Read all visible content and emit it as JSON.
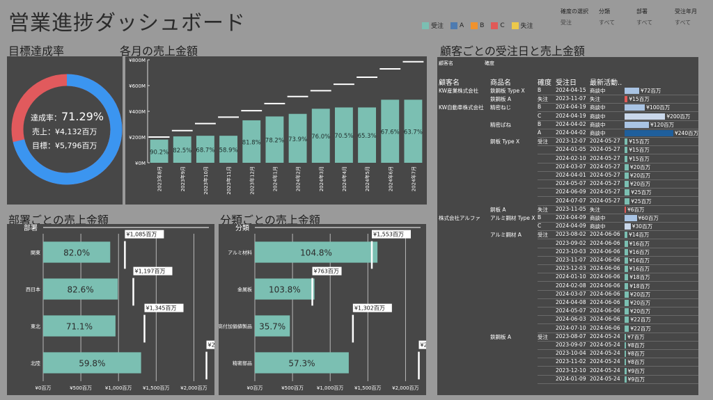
{
  "title": "営業進捗ダッシュボード",
  "legend": [
    {
      "label": "受注",
      "color": "#7bbfb2"
    },
    {
      "label": "A",
      "color": "#4e7bb0"
    },
    {
      "label": "B",
      "color": "#f0922e"
    },
    {
      "label": "C",
      "color": "#e15a57"
    },
    {
      "label": "失注",
      "color": "#ecc94b"
    }
  ],
  "filters": [
    {
      "label": "確度の選択",
      "value": "受注"
    },
    {
      "label": "分類",
      "value": "すべて"
    },
    {
      "label": "部署",
      "value": "すべて"
    },
    {
      "label": "受注年月",
      "value": "すべて"
    }
  ],
  "sections": {
    "goal": "目標達成率",
    "monthly": "各月の売上金額",
    "dept": "部署ごとの売上金額",
    "category": "分類ごとの売上金額",
    "customer": "顧客ごとの受注日と売上金額"
  },
  "goal": {
    "rate_label": "達成率：",
    "rate_value": "71.29%",
    "rate": 0.7129,
    "sales_label": "売上：",
    "sales_value": "¥4,132百万",
    "target_label": "目標：",
    "target_value": "¥5,796百万",
    "achieved_color": "#3b95f0",
    "remaining_color": "#e15a5d"
  },
  "chart_data": [
    {
      "type": "bar",
      "title": "各月の売上金額",
      "categories": [
        "2023年8月",
        "2023年9月",
        "2023年10月",
        "2023年11月",
        "2023年12月",
        "2024年1月",
        "2024年2月",
        "2024年3月",
        "2024年4月",
        "2024年5月",
        "2024年6月",
        "2024年7月"
      ],
      "values": [
        180,
        205,
        210,
        210,
        330,
        360,
        380,
        420,
        430,
        430,
        490,
        490
      ],
      "targets": [
        200,
        250,
        305,
        355,
        405,
        460,
        515,
        560,
        610,
        665,
        730,
        785
      ],
      "bar_labels": [
        "90.2%",
        "82.5%",
        "68.7%",
        "58.9%",
        "81.8%",
        "78.2%",
        "73.9%",
        "76.0%",
        "70.5%",
        "65.3%",
        "67.6%",
        "63.7%"
      ],
      "yticks": [
        "¥0M",
        "¥200M",
        "¥400M",
        "¥600M",
        "¥800M"
      ],
      "ylim": [
        0,
        800
      ],
      "color": "#7bbfb2"
    },
    {
      "type": "bar",
      "title": "部署ごとの売上金額",
      "axis_header": "部署",
      "categories": [
        "関東",
        "西日本",
        "東北",
        "北陸"
      ],
      "values": [
        890,
        990,
        960,
        1300
      ],
      "targets": [
        1085,
        1197,
        1345,
        2168
      ],
      "bar_labels": [
        "82.0%",
        "82.6%",
        "71.1%",
        "59.8%"
      ],
      "target_labels": [
        "¥1,085百万",
        "¥1,197百万",
        "¥1,345百万",
        "¥2,168百万"
      ],
      "xticks": [
        "¥0百万",
        "¥500百万",
        "¥1,000百万",
        "¥1,500百万",
        "¥2,000百万"
      ],
      "xlim": [
        0,
        2200
      ],
      "color": "#7bbfb2"
    },
    {
      "type": "bar",
      "title": "分類ごとの売上金額",
      "axis_header": "分類",
      "categories": [
        "アルミ材料",
        "金属板",
        "高付加価値製品",
        "精密部品"
      ],
      "values": [
        1628,
        792,
        465,
        1247
      ],
      "targets": [
        1553,
        763,
        1302,
        2177
      ],
      "bar_labels": [
        "104.8%",
        "103.8%",
        "35.7%",
        "57.3%"
      ],
      "target_labels": [
        "¥1,553百万",
        "¥763百万",
        "¥1,302百万",
        "¥2,177百万"
      ],
      "xticks": [
        "¥0百万",
        "¥500百万",
        "¥1,000百万",
        "¥1,500百万",
        "¥2,000百万"
      ],
      "xlim": [
        0,
        2200
      ],
      "color": "#7bbfb2"
    }
  ],
  "customer_table": {
    "filter_labels": [
      "顧客名",
      "確度"
    ],
    "columns": [
      "顧客名",
      "商品名",
      "確度",
      "受注日",
      "最新活動.."
    ],
    "bar_scale_max": 240,
    "rows": [
      {
        "customer": "KW産業株式会社",
        "product": "鉄鋼板 Type X",
        "grade": "B",
        "date": "2024-04-15",
        "activity": "商談中",
        "amount": 72,
        "label": "¥72百万",
        "color": "#a9c4e4"
      },
      {
        "customer": "",
        "product": "鉄鋼板 A",
        "grade": "失注",
        "date": "2023-11-07",
        "activity": "失注",
        "amount": 15,
        "label": "¥15百万",
        "color": "#e15a57"
      },
      {
        "customer": "KW自動車株式会社",
        "product": "精密ねじ",
        "grade": "B",
        "date": "2024-04-19",
        "activity": "商談中",
        "amount": 100,
        "label": "¥100百万",
        "color": "#a9c4e4"
      },
      {
        "customer": "",
        "product": "",
        "grade": "C",
        "date": "2024-04-19",
        "activity": "商談中",
        "amount": 200,
        "label": "¥200百万",
        "color": "#c9d7ea"
      },
      {
        "customer": "",
        "product": "精密ばね",
        "grade": "B",
        "date": "2024-04-02",
        "activity": "商談中",
        "amount": 120,
        "label": "¥120百万",
        "color": "#a9c4e4"
      },
      {
        "customer": "",
        "product": "",
        "grade": "A",
        "date": "2024-04-02",
        "activity": "商談中",
        "amount": 240,
        "label": "¥240百万",
        "color": "#1f5f9c"
      },
      {
        "customer": "",
        "product": "銅板 Type X",
        "grade": "受注",
        "date": "2023-12-07",
        "activity": "2024-05-27",
        "amount": 15,
        "label": "¥15百万",
        "color": "#7bbfb2"
      },
      {
        "customer": "",
        "product": "",
        "grade": "",
        "date": "2024-01-05",
        "activity": "2024-05-27",
        "amount": 15,
        "label": "¥15百万",
        "color": "#7bbfb2"
      },
      {
        "customer": "",
        "product": "",
        "grade": "",
        "date": "2024-02-10",
        "activity": "2024-05-27",
        "amount": 15,
        "label": "¥15百万",
        "color": "#7bbfb2"
      },
      {
        "customer": "",
        "product": "",
        "grade": "",
        "date": "2024-03-07",
        "activity": "2024-05-27",
        "amount": 20,
        "label": "¥20百万",
        "color": "#7bbfb2"
      },
      {
        "customer": "",
        "product": "",
        "grade": "",
        "date": "2024-04-01",
        "activity": "2024-05-27",
        "amount": 20,
        "label": "¥20百万",
        "color": "#7bbfb2"
      },
      {
        "customer": "",
        "product": "",
        "grade": "",
        "date": "2024-05-07",
        "activity": "2024-05-27",
        "amount": 20,
        "label": "¥20百万",
        "color": "#7bbfb2"
      },
      {
        "customer": "",
        "product": "",
        "grade": "",
        "date": "2024-06-09",
        "activity": "2024-05-27",
        "amount": 25,
        "label": "¥25百万",
        "color": "#7bbfb2"
      },
      {
        "customer": "",
        "product": "",
        "grade": "",
        "date": "2024-07-07",
        "activity": "2024-05-27",
        "amount": 25,
        "label": "¥25百万",
        "color": "#7bbfb2"
      },
      {
        "customer": "",
        "product": "銅板 A",
        "grade": "失注",
        "date": "2023-11-05",
        "activity": "失注",
        "amount": 6,
        "label": "¥6百万",
        "color": "#e15a57"
      },
      {
        "customer": "株式会社アルファ",
        "product": "アルミ鋼材 Type X",
        "grade": "B",
        "date": "2024-04-09",
        "activity": "商談中",
        "amount": 60,
        "label": "¥60百万",
        "color": "#a9c4e4"
      },
      {
        "customer": "",
        "product": "",
        "grade": "C",
        "date": "2024-04-09",
        "activity": "商談中",
        "amount": 30,
        "label": "¥30百万",
        "color": "#c9d7ea"
      },
      {
        "customer": "",
        "product": "アルミ鋼材 A",
        "grade": "受注",
        "date": "2023-08-02",
        "activity": "2024-06-06",
        "amount": 14,
        "label": "¥14百万",
        "color": "#7bbfb2"
      },
      {
        "customer": "",
        "product": "",
        "grade": "",
        "date": "2023-09-02",
        "activity": "2024-06-06",
        "amount": 16,
        "label": "¥16百万",
        "color": "#7bbfb2"
      },
      {
        "customer": "",
        "product": "",
        "grade": "",
        "date": "2023-10-03",
        "activity": "2024-06-06",
        "amount": 16,
        "label": "¥16百万",
        "color": "#7bbfb2"
      },
      {
        "customer": "",
        "product": "",
        "grade": "",
        "date": "2023-11-07",
        "activity": "2024-06-06",
        "amount": 16,
        "label": "¥16百万",
        "color": "#7bbfb2"
      },
      {
        "customer": "",
        "product": "",
        "grade": "",
        "date": "2023-12-03",
        "activity": "2024-06-06",
        "amount": 16,
        "label": "¥16百万",
        "color": "#7bbfb2"
      },
      {
        "customer": "",
        "product": "",
        "grade": "",
        "date": "2024-01-10",
        "activity": "2024-06-06",
        "amount": 18,
        "label": "¥18百万",
        "color": "#7bbfb2"
      },
      {
        "customer": "",
        "product": "",
        "grade": "",
        "date": "2024-02-08",
        "activity": "2024-06-06",
        "amount": 18,
        "label": "¥18百万",
        "color": "#7bbfb2"
      },
      {
        "customer": "",
        "product": "",
        "grade": "",
        "date": "2024-03-07",
        "activity": "2024-06-06",
        "amount": 20,
        "label": "¥20百万",
        "color": "#7bbfb2"
      },
      {
        "customer": "",
        "product": "",
        "grade": "",
        "date": "2024-04-08",
        "activity": "2024-06-06",
        "amount": 20,
        "label": "¥20百万",
        "color": "#7bbfb2"
      },
      {
        "customer": "",
        "product": "",
        "grade": "",
        "date": "2024-05-07",
        "activity": "2024-06-06",
        "amount": 20,
        "label": "¥20百万",
        "color": "#7bbfb2"
      },
      {
        "customer": "",
        "product": "",
        "grade": "",
        "date": "2024-06-03",
        "activity": "2024-06-06",
        "amount": 22,
        "label": "¥22百万",
        "color": "#7bbfb2"
      },
      {
        "customer": "",
        "product": "",
        "grade": "",
        "date": "2024-07-10",
        "activity": "2024-06-06",
        "amount": 22,
        "label": "¥22百万",
        "color": "#7bbfb2"
      },
      {
        "customer": "",
        "product": "鉄鋼板 A",
        "grade": "受注",
        "date": "2023-08-07",
        "activity": "2024-05-24",
        "amount": 7,
        "label": "¥7百万",
        "color": "#7bbfb2"
      },
      {
        "customer": "",
        "product": "",
        "grade": "",
        "date": "2023-09-07",
        "activity": "2024-05-24",
        "amount": 8,
        "label": "¥8百万",
        "color": "#7bbfb2"
      },
      {
        "customer": "",
        "product": "",
        "grade": "",
        "date": "2023-10-04",
        "activity": "2024-05-24",
        "amount": 8,
        "label": "¥8百万",
        "color": "#7bbfb2"
      },
      {
        "customer": "",
        "product": "",
        "grade": "",
        "date": "2023-11-02",
        "activity": "2024-05-24",
        "amount": 8,
        "label": "¥8百万",
        "color": "#7bbfb2"
      },
      {
        "customer": "",
        "product": "",
        "grade": "",
        "date": "2023-12-10",
        "activity": "2024-05-24",
        "amount": 9,
        "label": "¥9百万",
        "color": "#7bbfb2"
      },
      {
        "customer": "",
        "product": "",
        "grade": "",
        "date": "2024-01-09",
        "activity": "2024-05-24",
        "amount": 9,
        "label": "¥9百万",
        "color": "#7bbfb2"
      }
    ]
  }
}
